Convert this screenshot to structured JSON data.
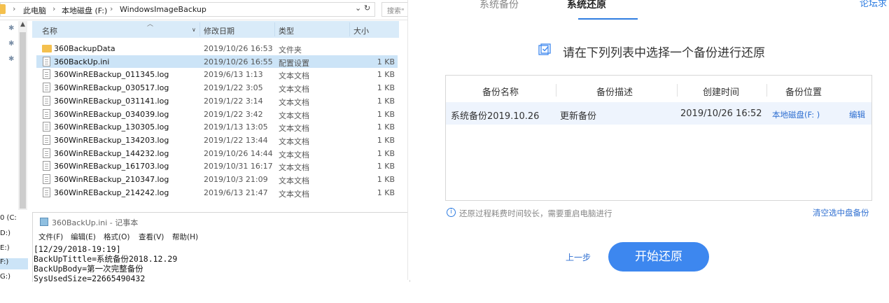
{
  "explorer": {
    "breadcrumb": [
      "此电脑",
      "本地磁盘 (F:)",
      "WindowsImageBackup"
    ],
    "breadcrumb_sep": "›",
    "nav_chevron": "›",
    "search_placeholder": "搜索\"",
    "columns": {
      "name": "名称",
      "date": "修改日期",
      "type": "类型",
      "size": "大小"
    },
    "files": [
      {
        "name": "360BackupData",
        "date": "2019/10/26 16:53",
        "type": "文件夹",
        "size": "",
        "icon": "folder-icon"
      },
      {
        "name": "360BackUp.ini",
        "date": "2019/10/26 16:55",
        "type": "配置设置",
        "size": "1 KB",
        "icon": "config-file-icon",
        "selected": true
      },
      {
        "name": "360WinREBackup_011345.log",
        "date": "2019/6/13 1:13",
        "type": "文本文档",
        "size": "1 KB",
        "icon": "text-file-icon"
      },
      {
        "name": "360WinREBackup_030517.log",
        "date": "2019/1/22 3:05",
        "type": "文本文档",
        "size": "1 KB",
        "icon": "text-file-icon"
      },
      {
        "name": "360WinREBackup_031141.log",
        "date": "2019/1/22 3:14",
        "type": "文本文档",
        "size": "1 KB",
        "icon": "text-file-icon"
      },
      {
        "name": "360WinREBackup_034039.log",
        "date": "2019/1/22 3:42",
        "type": "文本文档",
        "size": "1 KB",
        "icon": "text-file-icon"
      },
      {
        "name": "360WinREBackup_130305.log",
        "date": "2019/1/13 13:05",
        "type": "文本文档",
        "size": "1 KB",
        "icon": "text-file-icon"
      },
      {
        "name": "360WinREBackup_134203.log",
        "date": "2019/1/22 13:44",
        "type": "文本文档",
        "size": "1 KB",
        "icon": "text-file-icon"
      },
      {
        "name": "360WinREBackup_144232.log",
        "date": "2019/10/26 14:44",
        "type": "文本文档",
        "size": "1 KB",
        "icon": "text-file-icon"
      },
      {
        "name": "360WinREBackup_161703.log",
        "date": "2019/10/31 16:17",
        "type": "文本文档",
        "size": "1 KB",
        "icon": "text-file-icon"
      },
      {
        "name": "360WinREBackup_210347.log",
        "date": "2019/10/3 21:09",
        "type": "文本文档",
        "size": "1 KB",
        "icon": "text-file-icon"
      },
      {
        "name": "360WinREBackup_214242.log",
        "date": "2019/6/13 21:47",
        "type": "文本文档",
        "size": "1 KB",
        "icon": "text-file-icon"
      }
    ],
    "drives": [
      "0 (C:",
      "D:)",
      "E:)",
      "F:)",
      "G:)"
    ]
  },
  "notepad": {
    "title": "360BackUp.ini - 记事本",
    "menu": [
      "文件(F)",
      "编辑(E)",
      "格式(O)",
      "查看(V)",
      "帮助(H)"
    ],
    "lines": [
      "[12/29/2018-19:19]",
      "BackUpTittle=系统备份2018.12.29",
      "BackUpBody=第一次完整备份",
      "SysUsedSize=22665490432"
    ]
  },
  "dialog": {
    "tabs": [
      {
        "label": "系统备份",
        "active": false
      },
      {
        "label": "系统还原",
        "active": true
      }
    ],
    "forum_link": "论坛求",
    "select_title": "请在下列列表中选择一个备份进行还原",
    "table_headers": {
      "name": "备份名称",
      "desc": "备份描述",
      "time": "创建时间",
      "location": "备份位置"
    },
    "backups": [
      {
        "name": "系统备份2019.10.26",
        "desc": "更新备份",
        "time": "2019/10/26 16:52",
        "location": "本地磁盘(F: )",
        "action": "编辑"
      }
    ],
    "info_note": "还原过程耗费时间较长，需要重启电脑进行",
    "clear_link": "清空选中盘备份",
    "prev_label": "上一步",
    "start_label": "开始还原",
    "accent_color": "#3d87ef"
  }
}
